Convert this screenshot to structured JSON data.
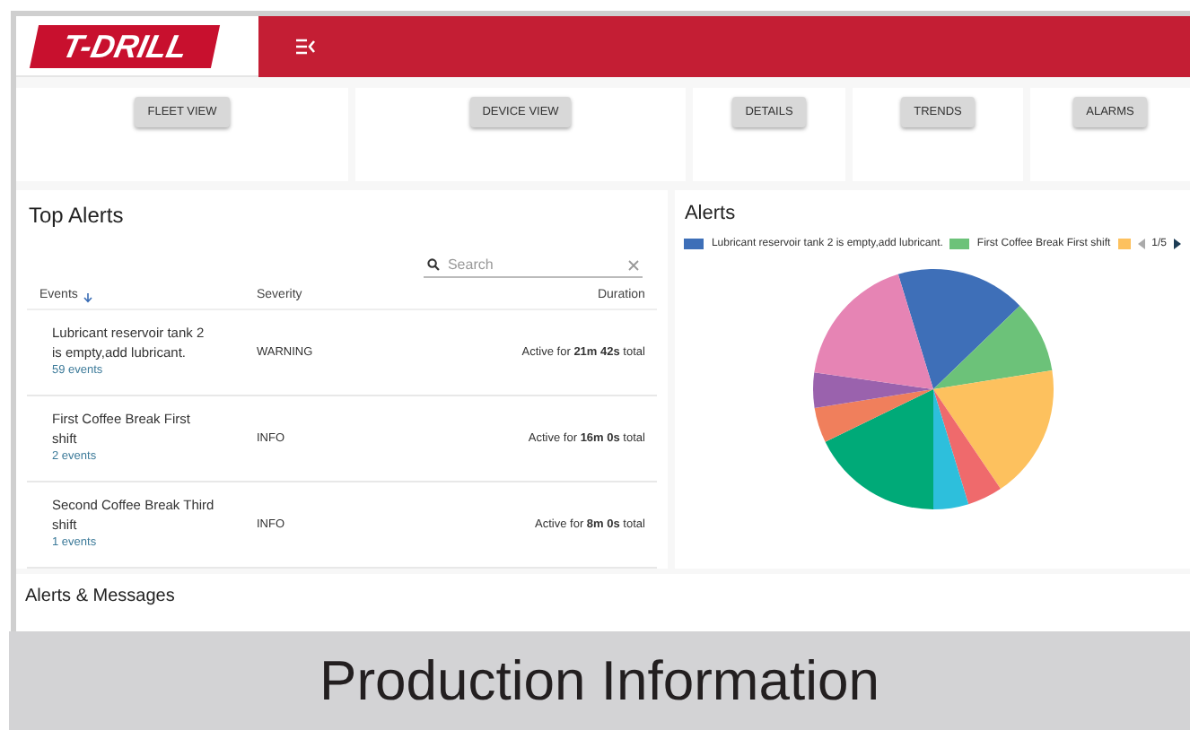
{
  "header": {
    "logo": "T-DRILL"
  },
  "nav_buttons": [
    {
      "label": "FLEET VIEW"
    },
    {
      "label": "DEVICE VIEW"
    },
    {
      "label": "DETAILS"
    },
    {
      "label": "TRENDS"
    },
    {
      "label": "ALARMS"
    }
  ],
  "top_alerts": {
    "title": "Top Alerts",
    "search": {
      "placeholder": "Search"
    },
    "columns": [
      "Events",
      "Severity",
      "Duration"
    ],
    "rows": [
      {
        "event": "Lubricant reservoir tank 2 is empty,add lubricant.",
        "count": "59 events",
        "severity": "WARNING",
        "duration": "Active for **21m 42s** total"
      },
      {
        "event": "First Coffee Break First shift",
        "count": "2 events",
        "severity": "INFO",
        "duration": "Active for **16m 0s** total"
      },
      {
        "event": "Second Coffee Break Third shift",
        "count": "1 events",
        "severity": "INFO",
        "duration": "Active for **8m 0s** total"
      }
    ]
  },
  "alerts_chart": {
    "title": "Alerts",
    "legend": [
      {
        "label": "Lubricant reservoir tank 2 is empty,add lubricant.",
        "color": "#3e6fb8"
      },
      {
        "label": "First Coffee Break First shift",
        "color": "#6cc279"
      },
      {
        "color": "#fdc15e"
      }
    ],
    "page": "1/5"
  },
  "alerts_messages": {
    "title": "Alerts & Messages"
  },
  "caption": "Production Information"
}
